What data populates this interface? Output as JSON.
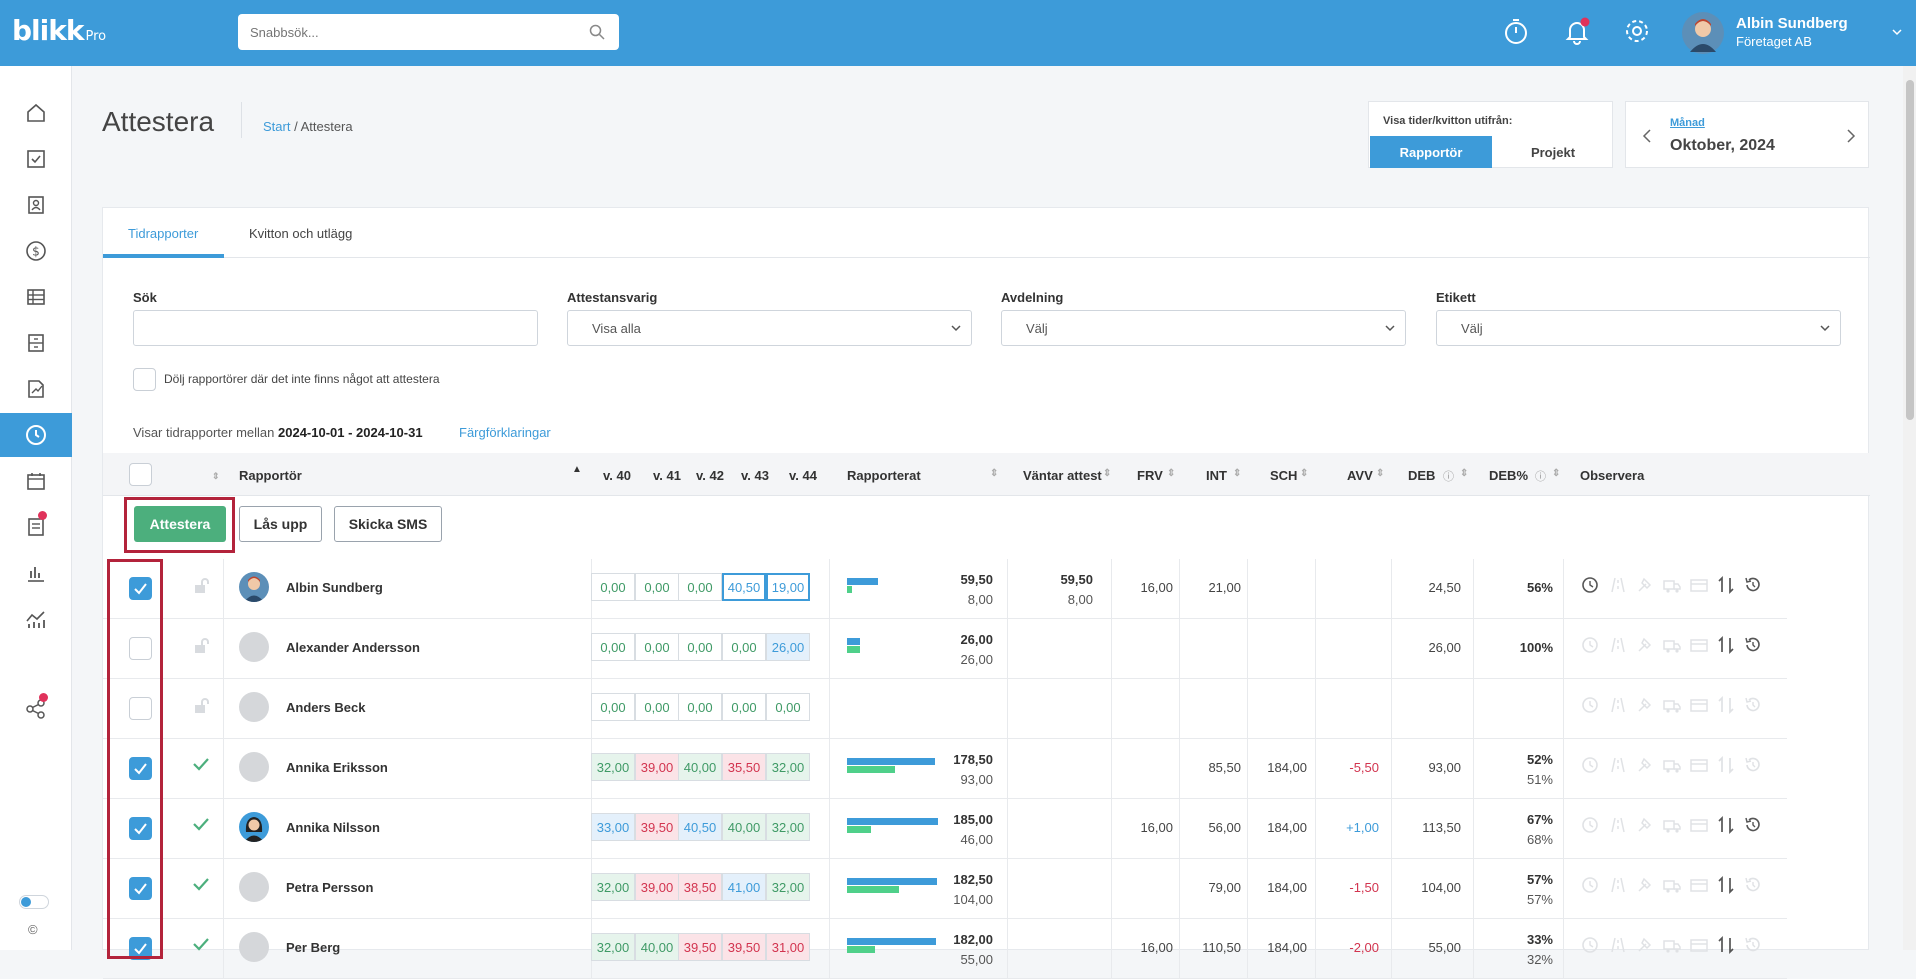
{
  "app": {
    "logo": "blikk",
    "logo_suffix": "Pro"
  },
  "search": {
    "placeholder": "Snabbsök..."
  },
  "user": {
    "name": "Albin Sundberg",
    "company": "Företaget AB"
  },
  "page": {
    "title": "Attestera",
    "breadcrumb_home": "Start",
    "breadcrumb_sep": " / ",
    "breadcrumb_current": "Attestera"
  },
  "view": {
    "label": "Visa tider/kvitton utifrån:",
    "option_1": "Rapportör",
    "option_2": "Projekt"
  },
  "period": {
    "type": "Månad",
    "value": "Oktober, 2024"
  },
  "tabs": {
    "tab_1": "Tidrapporter",
    "tab_2": "Kvitton och utlägg"
  },
  "filters": {
    "search_label": "Sök",
    "attest_label": "Attestansvarig",
    "attest_value": "Visa alla",
    "dept_label": "Avdelning",
    "dept_value": "Välj",
    "tag_label": "Etikett",
    "tag_value": "Välj",
    "hide_label": "Dölj rapportörer där det inte finns något att attestera"
  },
  "range": {
    "prefix": "Visar tidrapporter mellan ",
    "dates": "2024-10-01 - 2024-10-31",
    "legend_link": "Färgförklaringar"
  },
  "columns": {
    "reporter": "Rapportör",
    "w40": "v. 40",
    "w41": "v. 41",
    "w42": "v. 42",
    "w43": "v. 43",
    "w44": "v. 44",
    "reported": "Rapporterat",
    "waiting": "Väntar attest",
    "frv": "FRV",
    "int": "INT",
    "sch": "SCH",
    "avv": "AVV",
    "deb": "DEB",
    "debp": "DEB%",
    "observe": "Observera"
  },
  "actions": {
    "approve": "Attestera",
    "unlock": "Lås upp",
    "sms": "Skicka SMS"
  },
  "colors": {
    "primary": "#3d9bd9",
    "green": "#4caf7d",
    "red": "#d2344f",
    "highlight": "#b3233b"
  },
  "rows": [
    {
      "name": "Albin Sundberg",
      "weeks": [
        "0,00",
        "0,00",
        "0,00",
        "40,50",
        "19,00"
      ],
      "reported": "59,50",
      "reported_sub": "8,00",
      "waiting": "59,50",
      "waiting_sub": "8,00",
      "frv": "16,00",
      "int": "21,00",
      "sch": "",
      "avv": "",
      "deb": "24,50",
      "debp": "56%",
      "debp_sub": ""
    },
    {
      "name": "Alexander Andersson",
      "weeks": [
        "0,00",
        "0,00",
        "0,00",
        "0,00",
        "26,00"
      ],
      "reported": "26,00",
      "reported_sub": "26,00",
      "waiting": "",
      "waiting_sub": "",
      "frv": "",
      "int": "",
      "sch": "",
      "avv": "",
      "deb": "26,00",
      "debp": "100%",
      "debp_sub": ""
    },
    {
      "name": "Anders Beck",
      "weeks": [
        "0,00",
        "0,00",
        "0,00",
        "0,00",
        "0,00"
      ],
      "reported": "",
      "reported_sub": "",
      "waiting": "",
      "waiting_sub": "",
      "frv": "",
      "int": "",
      "sch": "",
      "avv": "",
      "deb": "",
      "debp": "",
      "debp_sub": ""
    },
    {
      "name": "Annika Eriksson",
      "weeks": [
        "32,00",
        "39,00",
        "40,00",
        "35,50",
        "32,00"
      ],
      "reported": "178,50",
      "reported_sub": "93,00",
      "waiting": "",
      "waiting_sub": "",
      "frv": "",
      "int": "85,50",
      "sch": "184,00",
      "avv": "-5,50",
      "deb": "93,00",
      "debp": "52%",
      "debp_sub": "51%"
    },
    {
      "name": "Annika Nilsson",
      "weeks": [
        "33,00",
        "39,50",
        "40,50",
        "40,00",
        "32,00"
      ],
      "reported": "185,00",
      "reported_sub": "46,00",
      "waiting": "",
      "waiting_sub": "",
      "frv": "16,00",
      "int": "56,00",
      "sch": "184,00",
      "avv": "+1,00",
      "deb": "113,50",
      "debp": "67%",
      "debp_sub": "68%"
    },
    {
      "name": "Petra Persson",
      "weeks": [
        "32,00",
        "39,00",
        "38,50",
        "41,00",
        "32,00"
      ],
      "reported": "182,50",
      "reported_sub": "104,00",
      "waiting": "",
      "waiting_sub": "",
      "frv": "",
      "int": "79,00",
      "sch": "184,00",
      "avv": "-1,50",
      "deb": "104,00",
      "debp": "57%",
      "debp_sub": "57%"
    },
    {
      "name": "Per Berg",
      "weeks": [
        "32,00",
        "40,00",
        "39,50",
        "39,50",
        "31,00"
      ],
      "reported": "182,00",
      "reported_sub": "55,00",
      "waiting": "",
      "waiting_sub": "",
      "frv": "16,00",
      "int": "110,50",
      "sch": "184,00",
      "avv": "-2,00",
      "deb": "55,00",
      "debp": "33%",
      "debp_sub": "32%"
    }
  ],
  "footer": {
    "copyright": "©"
  }
}
